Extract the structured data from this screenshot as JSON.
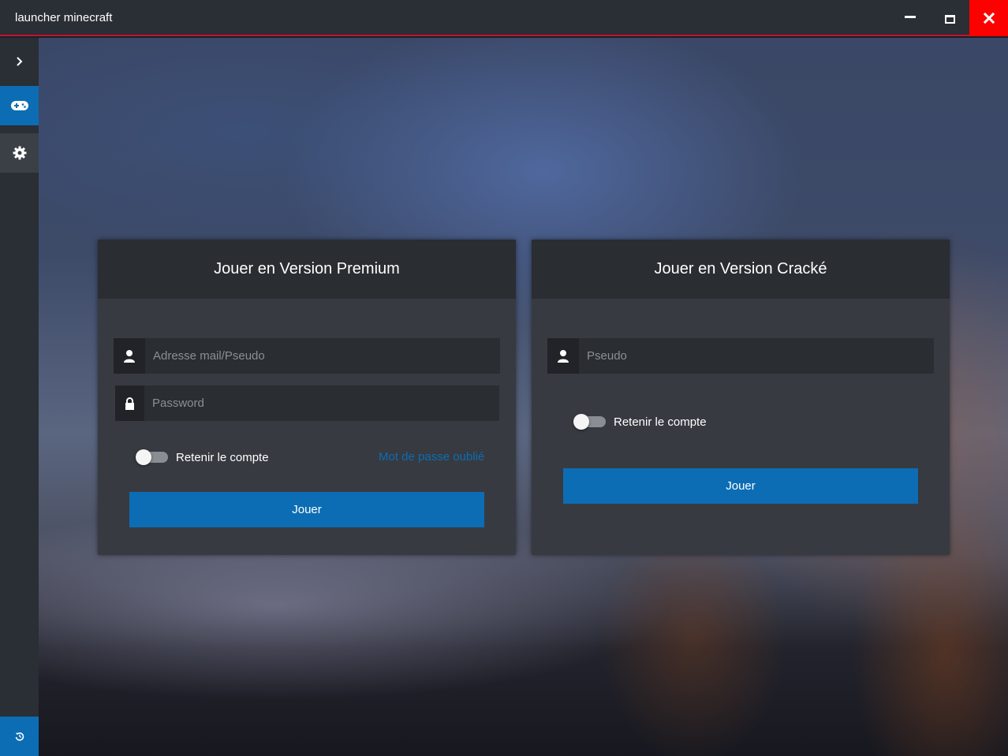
{
  "window": {
    "title": "launcher minecraft",
    "accent_color": "#c8102e",
    "close_color": "#ff0000"
  },
  "sidebar": {
    "items": [
      {
        "name": "expand",
        "icon": "chevron-right-icon"
      },
      {
        "name": "game",
        "icon": "gamepad-icon",
        "active": true
      },
      {
        "name": "settings",
        "icon": "gear-icon"
      },
      {
        "name": "history",
        "icon": "history-icon"
      }
    ],
    "active_color": "#0c6db4"
  },
  "premium": {
    "title": "Jouer en Version Premium",
    "login_placeholder": "Adresse mail/Pseudo",
    "password_placeholder": "Password",
    "remember_label": "Retenir le compte",
    "remember_checked": false,
    "forgot_label": "Mot de passe oublié",
    "play_label": "Jouer"
  },
  "cracked": {
    "title": "Jouer en Version Cracké",
    "pseudo_placeholder": "Pseudo",
    "remember_label": "Retenir le compte",
    "remember_checked": false,
    "play_label": "Jouer"
  }
}
